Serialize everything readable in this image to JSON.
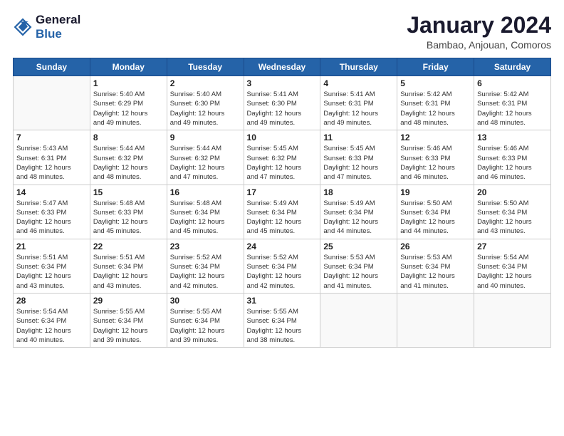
{
  "logo": {
    "line1": "General",
    "line2": "Blue"
  },
  "title": "January 2024",
  "subtitle": "Bambao, Anjouan, Comoros",
  "days_header": [
    "Sunday",
    "Monday",
    "Tuesday",
    "Wednesday",
    "Thursday",
    "Friday",
    "Saturday"
  ],
  "weeks": [
    [
      {
        "day": "",
        "info": ""
      },
      {
        "day": "1",
        "info": "Sunrise: 5:40 AM\nSunset: 6:29 PM\nDaylight: 12 hours\nand 49 minutes."
      },
      {
        "day": "2",
        "info": "Sunrise: 5:40 AM\nSunset: 6:30 PM\nDaylight: 12 hours\nand 49 minutes."
      },
      {
        "day": "3",
        "info": "Sunrise: 5:41 AM\nSunset: 6:30 PM\nDaylight: 12 hours\nand 49 minutes."
      },
      {
        "day": "4",
        "info": "Sunrise: 5:41 AM\nSunset: 6:31 PM\nDaylight: 12 hours\nand 49 minutes."
      },
      {
        "day": "5",
        "info": "Sunrise: 5:42 AM\nSunset: 6:31 PM\nDaylight: 12 hours\nand 48 minutes."
      },
      {
        "day": "6",
        "info": "Sunrise: 5:42 AM\nSunset: 6:31 PM\nDaylight: 12 hours\nand 48 minutes."
      }
    ],
    [
      {
        "day": "7",
        "info": "Sunrise: 5:43 AM\nSunset: 6:31 PM\nDaylight: 12 hours\nand 48 minutes."
      },
      {
        "day": "8",
        "info": "Sunrise: 5:44 AM\nSunset: 6:32 PM\nDaylight: 12 hours\nand 48 minutes."
      },
      {
        "day": "9",
        "info": "Sunrise: 5:44 AM\nSunset: 6:32 PM\nDaylight: 12 hours\nand 47 minutes."
      },
      {
        "day": "10",
        "info": "Sunrise: 5:45 AM\nSunset: 6:32 PM\nDaylight: 12 hours\nand 47 minutes."
      },
      {
        "day": "11",
        "info": "Sunrise: 5:45 AM\nSunset: 6:33 PM\nDaylight: 12 hours\nand 47 minutes."
      },
      {
        "day": "12",
        "info": "Sunrise: 5:46 AM\nSunset: 6:33 PM\nDaylight: 12 hours\nand 46 minutes."
      },
      {
        "day": "13",
        "info": "Sunrise: 5:46 AM\nSunset: 6:33 PM\nDaylight: 12 hours\nand 46 minutes."
      }
    ],
    [
      {
        "day": "14",
        "info": "Sunrise: 5:47 AM\nSunset: 6:33 PM\nDaylight: 12 hours\nand 46 minutes."
      },
      {
        "day": "15",
        "info": "Sunrise: 5:48 AM\nSunset: 6:33 PM\nDaylight: 12 hours\nand 45 minutes."
      },
      {
        "day": "16",
        "info": "Sunrise: 5:48 AM\nSunset: 6:34 PM\nDaylight: 12 hours\nand 45 minutes."
      },
      {
        "day": "17",
        "info": "Sunrise: 5:49 AM\nSunset: 6:34 PM\nDaylight: 12 hours\nand 45 minutes."
      },
      {
        "day": "18",
        "info": "Sunrise: 5:49 AM\nSunset: 6:34 PM\nDaylight: 12 hours\nand 44 minutes."
      },
      {
        "day": "19",
        "info": "Sunrise: 5:50 AM\nSunset: 6:34 PM\nDaylight: 12 hours\nand 44 minutes."
      },
      {
        "day": "20",
        "info": "Sunrise: 5:50 AM\nSunset: 6:34 PM\nDaylight: 12 hours\nand 43 minutes."
      }
    ],
    [
      {
        "day": "21",
        "info": "Sunrise: 5:51 AM\nSunset: 6:34 PM\nDaylight: 12 hours\nand 43 minutes."
      },
      {
        "day": "22",
        "info": "Sunrise: 5:51 AM\nSunset: 6:34 PM\nDaylight: 12 hours\nand 43 minutes."
      },
      {
        "day": "23",
        "info": "Sunrise: 5:52 AM\nSunset: 6:34 PM\nDaylight: 12 hours\nand 42 minutes."
      },
      {
        "day": "24",
        "info": "Sunrise: 5:52 AM\nSunset: 6:34 PM\nDaylight: 12 hours\nand 42 minutes."
      },
      {
        "day": "25",
        "info": "Sunrise: 5:53 AM\nSunset: 6:34 PM\nDaylight: 12 hours\nand 41 minutes."
      },
      {
        "day": "26",
        "info": "Sunrise: 5:53 AM\nSunset: 6:34 PM\nDaylight: 12 hours\nand 41 minutes."
      },
      {
        "day": "27",
        "info": "Sunrise: 5:54 AM\nSunset: 6:34 PM\nDaylight: 12 hours\nand 40 minutes."
      }
    ],
    [
      {
        "day": "28",
        "info": "Sunrise: 5:54 AM\nSunset: 6:34 PM\nDaylight: 12 hours\nand 40 minutes."
      },
      {
        "day": "29",
        "info": "Sunrise: 5:55 AM\nSunset: 6:34 PM\nDaylight: 12 hours\nand 39 minutes."
      },
      {
        "day": "30",
        "info": "Sunrise: 5:55 AM\nSunset: 6:34 PM\nDaylight: 12 hours\nand 39 minutes."
      },
      {
        "day": "31",
        "info": "Sunrise: 5:55 AM\nSunset: 6:34 PM\nDaylight: 12 hours\nand 38 minutes."
      },
      {
        "day": "",
        "info": ""
      },
      {
        "day": "",
        "info": ""
      },
      {
        "day": "",
        "info": ""
      }
    ]
  ]
}
